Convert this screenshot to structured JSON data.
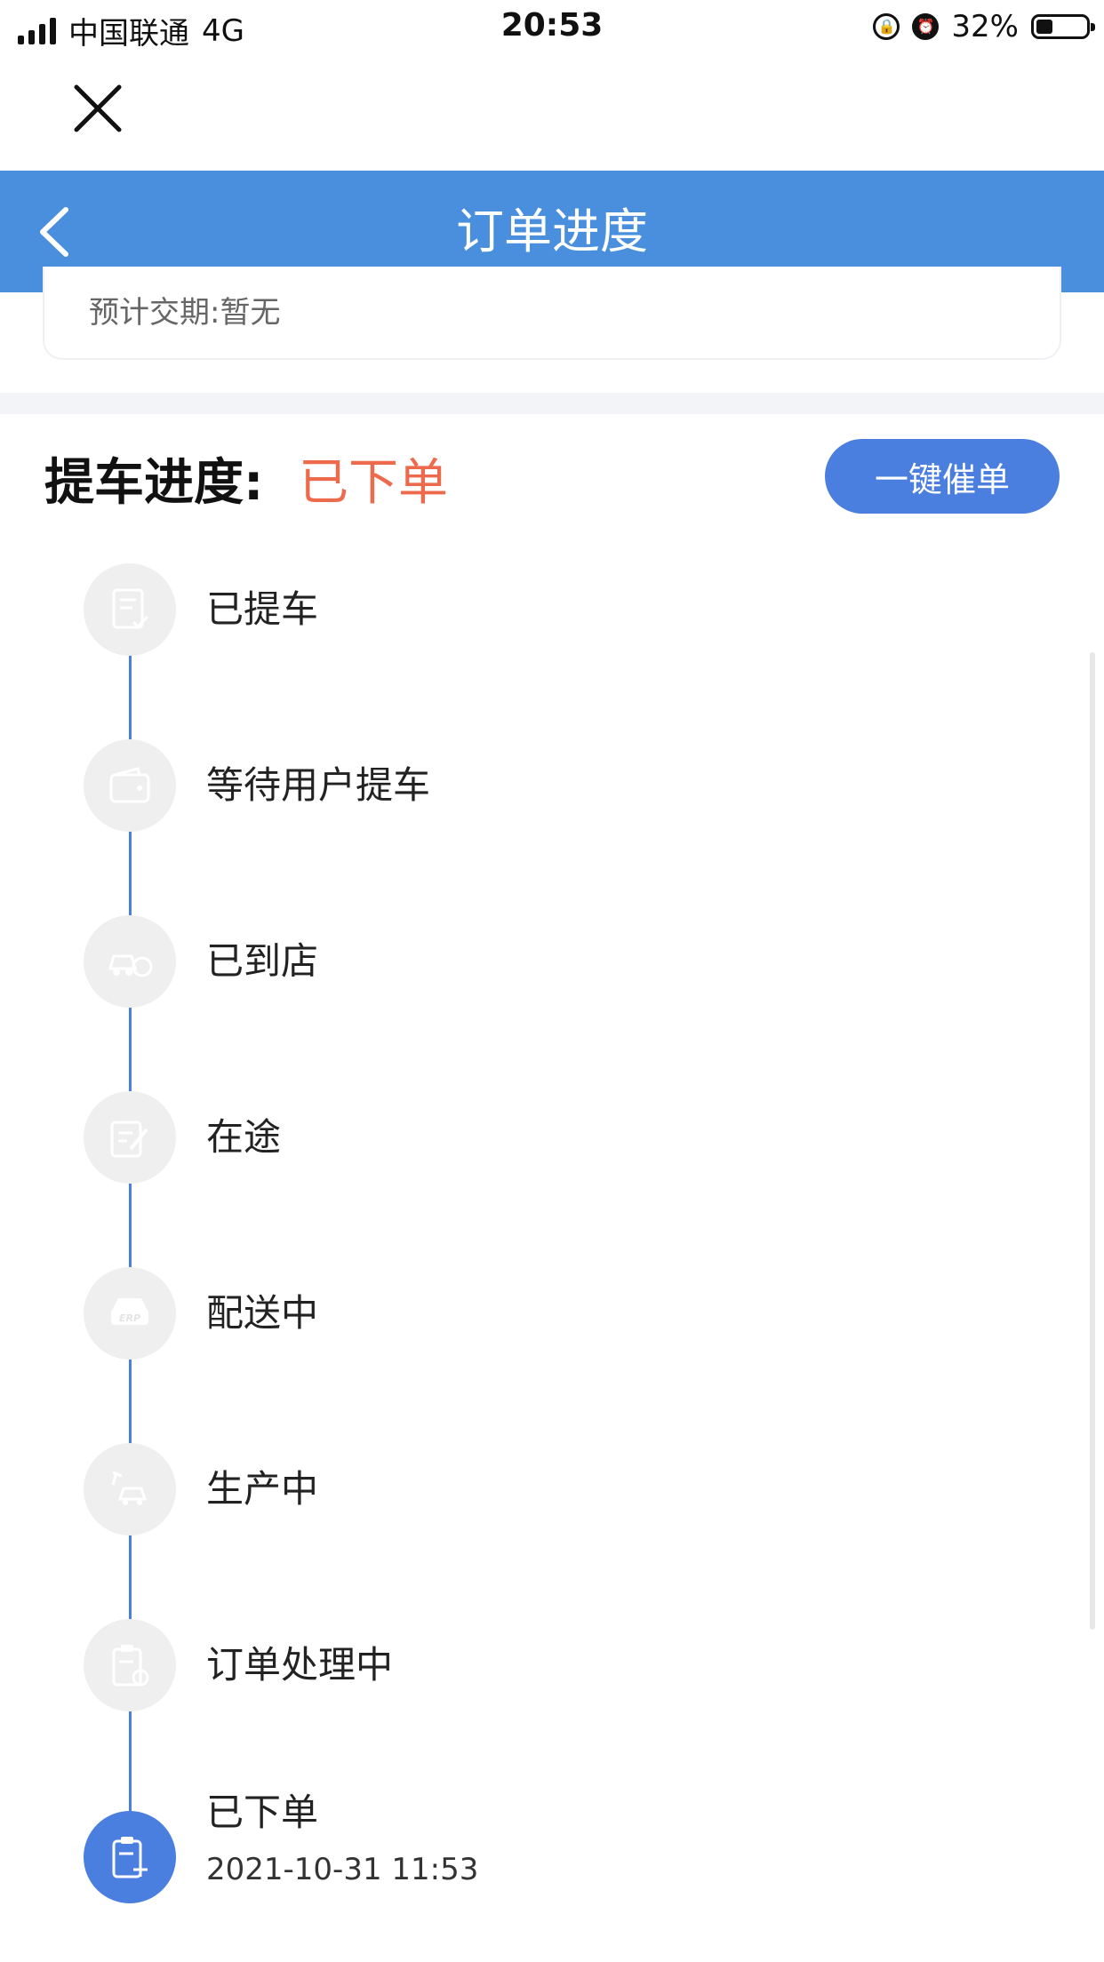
{
  "status_bar": {
    "carrier": "中国联通",
    "network": "4G",
    "time": "20:53",
    "battery": "32%",
    "battery_level": 0.32
  },
  "header": {
    "title": "订单进度"
  },
  "summary": {
    "delivery_label": "预计交期:",
    "delivery_value": "暂无"
  },
  "progress": {
    "label": "提车进度:",
    "status": "已下单",
    "urge_button": "一键催单"
  },
  "timeline": {
    "steps": [
      {
        "label": "已提车",
        "icon": "document-check-icon",
        "active": false
      },
      {
        "label": "等待用户提车",
        "icon": "wallet-icon",
        "active": false
      },
      {
        "label": "已到店",
        "icon": "car-store-icon",
        "active": false
      },
      {
        "label": "在途",
        "icon": "edit-note-icon",
        "active": false
      },
      {
        "label": "配送中",
        "icon": "erp-car-icon",
        "active": false
      },
      {
        "label": "生产中",
        "icon": "car-production-icon",
        "active": false
      },
      {
        "label": "订单处理中",
        "icon": "clipboard-clock-icon",
        "active": false
      },
      {
        "label": "已下单",
        "icon": "clipboard-plus-icon",
        "active": true,
        "time": "2021-10-31 11:53"
      }
    ]
  },
  "colors": {
    "header_bg": "#4a8fdd",
    "accent": "#4a7fe0",
    "status_red": "#ee6a4c",
    "inactive_circle": "#efefef"
  }
}
